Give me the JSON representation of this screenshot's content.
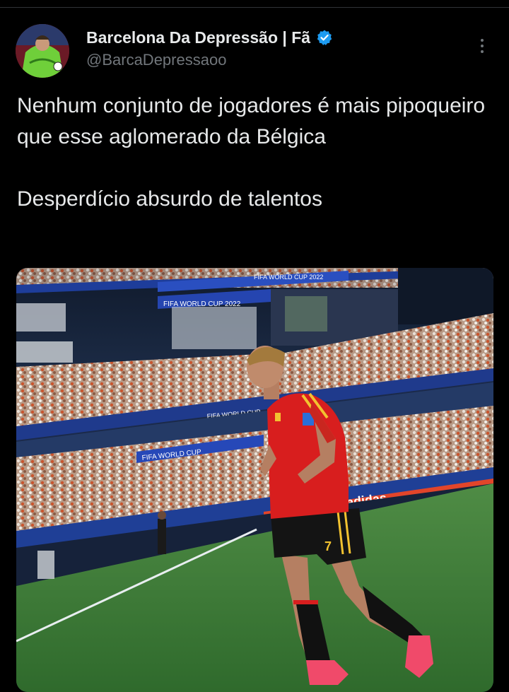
{
  "tweet": {
    "display_name": "Barcelona Da Depressão | Fã",
    "handle": "@BarcaDepressaoo",
    "verified": true,
    "text_paragraph_1": "Nenhum conjunto de jogadores é mais pipoqueiro que esse aglomerado da Bélgica",
    "text_paragraph_2": "Desperdício absurdo de talentos"
  },
  "media": {
    "stadium_banner_1": "FIFA WORLD CUP 2022",
    "stadium_banner_2": "FIFA WORLD CUP 2022",
    "stadium_banner_3": "FIFA WORLD CUP",
    "stadium_banner_4": "FIFA WORLD CUP",
    "ad_board": "adidas",
    "player_number": "7"
  },
  "colors": {
    "background": "#000000",
    "text_primary": "#e7e9ea",
    "text_secondary": "#71767b",
    "verified_blue": "#1d9bf0",
    "jersey_red": "#d81e1e",
    "pitch_green": "#3f7a3a"
  }
}
